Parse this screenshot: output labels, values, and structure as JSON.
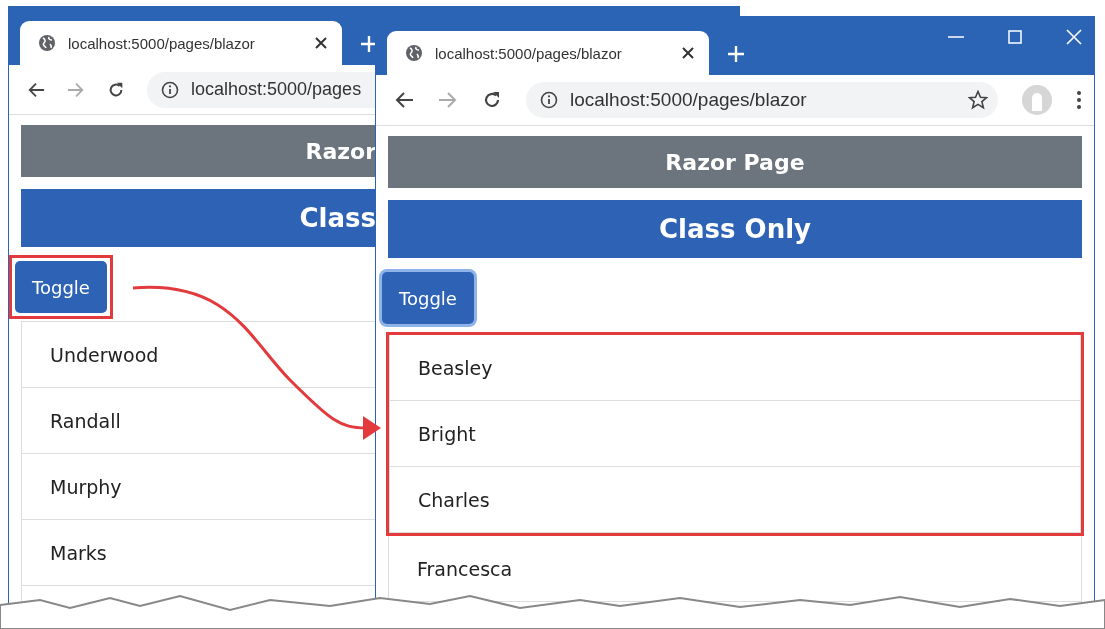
{
  "windows": [
    {
      "tab_title": "localhost:5000/pages/blazor",
      "address": "localhost:5000/pages",
      "header": "Razor",
      "subheader": "Class",
      "toggle_button": {
        "label": "Toggle",
        "focused": false,
        "highlighted": true
      },
      "items": [
        {
          "name": "Underwood",
          "highlighted": false
        },
        {
          "name": "Randall",
          "highlighted": false
        },
        {
          "name": "Murphy",
          "highlighted": false
        },
        {
          "name": "Marks",
          "highlighted": false
        }
      ]
    },
    {
      "tab_title": "localhost:5000/pages/blazor",
      "address": "localhost:5000/pages/blazor",
      "header": "Razor Page",
      "subheader": "Class Only",
      "toggle_button": {
        "label": "Toggle",
        "focused": true,
        "highlighted": false
      },
      "items": [
        {
          "name": "Beasley",
          "highlighted": true
        },
        {
          "name": "Bright",
          "highlighted": true
        },
        {
          "name": "Charles",
          "highlighted": true
        },
        {
          "name": "Francesca",
          "highlighted": false
        }
      ]
    }
  ]
}
